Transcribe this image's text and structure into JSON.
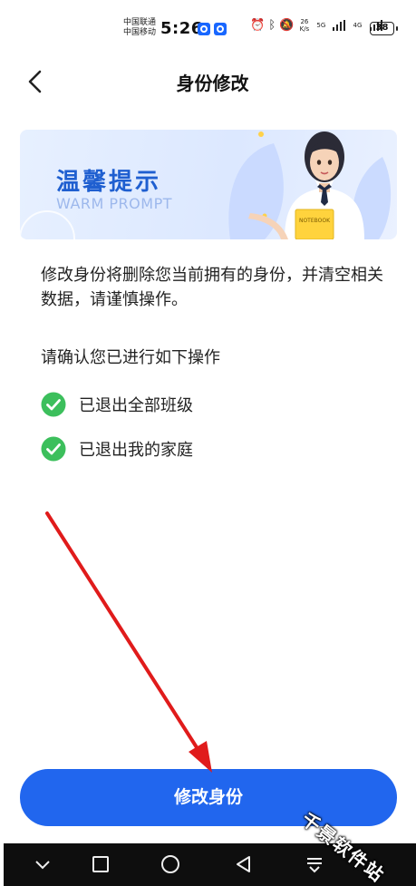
{
  "status_bar": {
    "carrier_1": "中国联通",
    "carrier_2": "中国移动",
    "time": "5:26",
    "net_speed_value": "26",
    "net_speed_unit": "K/s",
    "net_type_1": "5G",
    "net_type_2": "4G",
    "battery": "38"
  },
  "header": {
    "title": "身份修改"
  },
  "banner": {
    "title": "温馨提示",
    "subtitle": "WARM PROMPT",
    "book_label": "NOTEBOOK"
  },
  "notice": {
    "text": "修改身份将删除您当前拥有的身份，并清空相关数据，请谨慎操作。"
  },
  "confirm": {
    "heading": "请确认您已进行如下操作",
    "items": [
      {
        "label": "已退出全部班级",
        "checked": true
      },
      {
        "label": "已退出我的家庭",
        "checked": true
      }
    ],
    "check_color": "#3cbf5c"
  },
  "primary_button": {
    "label": "修改身份",
    "color": "#2166ee"
  },
  "watermark": {
    "text": "千景软件站"
  },
  "nav_bar": {
    "icons": [
      "chevron-down-icon",
      "recents-square-icon",
      "home-circle-icon",
      "back-triangle-icon",
      "notification-pull-icon"
    ]
  }
}
